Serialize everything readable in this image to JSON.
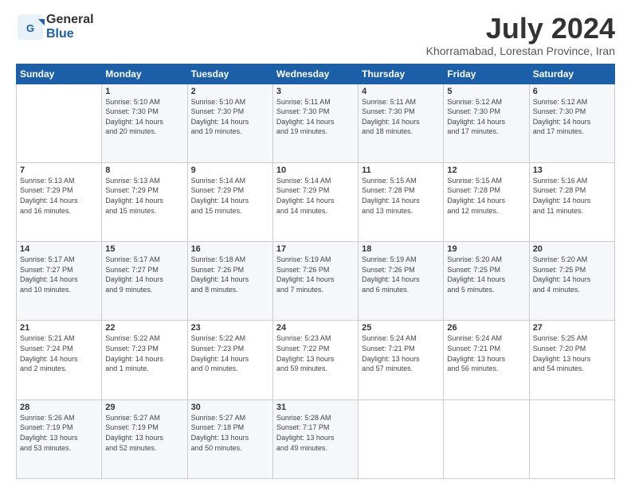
{
  "logo": {
    "line1": "General",
    "line2": "Blue"
  },
  "title": "July 2024",
  "subtitle": "Khorramabad, Lorestan Province, Iran",
  "days_header": [
    "Sunday",
    "Monday",
    "Tuesday",
    "Wednesday",
    "Thursday",
    "Friday",
    "Saturday"
  ],
  "weeks": [
    [
      {
        "day": "",
        "info": ""
      },
      {
        "day": "1",
        "info": "Sunrise: 5:10 AM\nSunset: 7:30 PM\nDaylight: 14 hours\nand 20 minutes."
      },
      {
        "day": "2",
        "info": "Sunrise: 5:10 AM\nSunset: 7:30 PM\nDaylight: 14 hours\nand 19 minutes."
      },
      {
        "day": "3",
        "info": "Sunrise: 5:11 AM\nSunset: 7:30 PM\nDaylight: 14 hours\nand 19 minutes."
      },
      {
        "day": "4",
        "info": "Sunrise: 5:11 AM\nSunset: 7:30 PM\nDaylight: 14 hours\nand 18 minutes."
      },
      {
        "day": "5",
        "info": "Sunrise: 5:12 AM\nSunset: 7:30 PM\nDaylight: 14 hours\nand 17 minutes."
      },
      {
        "day": "6",
        "info": "Sunrise: 5:12 AM\nSunset: 7:30 PM\nDaylight: 14 hours\nand 17 minutes."
      }
    ],
    [
      {
        "day": "7",
        "info": "Sunrise: 5:13 AM\nSunset: 7:29 PM\nDaylight: 14 hours\nand 16 minutes."
      },
      {
        "day": "8",
        "info": "Sunrise: 5:13 AM\nSunset: 7:29 PM\nDaylight: 14 hours\nand 15 minutes."
      },
      {
        "day": "9",
        "info": "Sunrise: 5:14 AM\nSunset: 7:29 PM\nDaylight: 14 hours\nand 15 minutes."
      },
      {
        "day": "10",
        "info": "Sunrise: 5:14 AM\nSunset: 7:29 PM\nDaylight: 14 hours\nand 14 minutes."
      },
      {
        "day": "11",
        "info": "Sunrise: 5:15 AM\nSunset: 7:28 PM\nDaylight: 14 hours\nand 13 minutes."
      },
      {
        "day": "12",
        "info": "Sunrise: 5:15 AM\nSunset: 7:28 PM\nDaylight: 14 hours\nand 12 minutes."
      },
      {
        "day": "13",
        "info": "Sunrise: 5:16 AM\nSunset: 7:28 PM\nDaylight: 14 hours\nand 11 minutes."
      }
    ],
    [
      {
        "day": "14",
        "info": "Sunrise: 5:17 AM\nSunset: 7:27 PM\nDaylight: 14 hours\nand 10 minutes."
      },
      {
        "day": "15",
        "info": "Sunrise: 5:17 AM\nSunset: 7:27 PM\nDaylight: 14 hours\nand 9 minutes."
      },
      {
        "day": "16",
        "info": "Sunrise: 5:18 AM\nSunset: 7:26 PM\nDaylight: 14 hours\nand 8 minutes."
      },
      {
        "day": "17",
        "info": "Sunrise: 5:19 AM\nSunset: 7:26 PM\nDaylight: 14 hours\nand 7 minutes."
      },
      {
        "day": "18",
        "info": "Sunrise: 5:19 AM\nSunset: 7:26 PM\nDaylight: 14 hours\nand 6 minutes."
      },
      {
        "day": "19",
        "info": "Sunrise: 5:20 AM\nSunset: 7:25 PM\nDaylight: 14 hours\nand 5 minutes."
      },
      {
        "day": "20",
        "info": "Sunrise: 5:20 AM\nSunset: 7:25 PM\nDaylight: 14 hours\nand 4 minutes."
      }
    ],
    [
      {
        "day": "21",
        "info": "Sunrise: 5:21 AM\nSunset: 7:24 PM\nDaylight: 14 hours\nand 2 minutes."
      },
      {
        "day": "22",
        "info": "Sunrise: 5:22 AM\nSunset: 7:23 PM\nDaylight: 14 hours\nand 1 minute."
      },
      {
        "day": "23",
        "info": "Sunrise: 5:22 AM\nSunset: 7:23 PM\nDaylight: 14 hours\nand 0 minutes."
      },
      {
        "day": "24",
        "info": "Sunrise: 5:23 AM\nSunset: 7:22 PM\nDaylight: 13 hours\nand 59 minutes."
      },
      {
        "day": "25",
        "info": "Sunrise: 5:24 AM\nSunset: 7:21 PM\nDaylight: 13 hours\nand 57 minutes."
      },
      {
        "day": "26",
        "info": "Sunrise: 5:24 AM\nSunset: 7:21 PM\nDaylight: 13 hours\nand 56 minutes."
      },
      {
        "day": "27",
        "info": "Sunrise: 5:25 AM\nSunset: 7:20 PM\nDaylight: 13 hours\nand 54 minutes."
      }
    ],
    [
      {
        "day": "28",
        "info": "Sunrise: 5:26 AM\nSunset: 7:19 PM\nDaylight: 13 hours\nand 53 minutes."
      },
      {
        "day": "29",
        "info": "Sunrise: 5:27 AM\nSunset: 7:19 PM\nDaylight: 13 hours\nand 52 minutes."
      },
      {
        "day": "30",
        "info": "Sunrise: 5:27 AM\nSunset: 7:18 PM\nDaylight: 13 hours\nand 50 minutes."
      },
      {
        "day": "31",
        "info": "Sunrise: 5:28 AM\nSunset: 7:17 PM\nDaylight: 13 hours\nand 49 minutes."
      },
      {
        "day": "",
        "info": ""
      },
      {
        "day": "",
        "info": ""
      },
      {
        "day": "",
        "info": ""
      }
    ]
  ]
}
